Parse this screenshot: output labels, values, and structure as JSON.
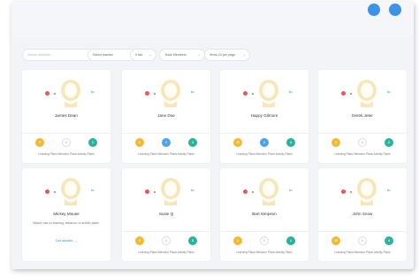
{
  "header": {
    "title": "",
    "right_labels": [
      "",
      ""
    ]
  },
  "filters": {
    "search_placeholder": "Search students",
    "selects": [
      {
        "label": "Select teacher"
      },
      {
        "label": "0 tab"
      },
      {
        "label": "Team Members"
      },
      {
        "label": "Show 24 per page"
      }
    ]
  },
  "footer_label": "Learning Plans  Behavior Plans  Activity Plans",
  "colors": {
    "yellow": "#f4b833",
    "blue": "#4da1ec",
    "teal": "#2bb39a",
    "red": "#e25959",
    "accent": "#3d93e8"
  },
  "students": [
    {
      "name": "James Dean",
      "tag": "lu",
      "learning": "0",
      "behavior": "0",
      "activity": "1",
      "b_style": "empty"
    },
    {
      "name": "Jane Doe",
      "tag": "lu",
      "learning": "0",
      "behavior": "2",
      "activity": "3",
      "b_style": "blue"
    },
    {
      "name": "Happy Gilmore",
      "tag": "lu",
      "learning": "10",
      "behavior": "2",
      "activity": "4",
      "b_style": "blue"
    },
    {
      "name": "Derek Jeter",
      "tag": "lu",
      "learning": "2",
      "behavior": "0",
      "activity": "2",
      "b_style": "empty"
    },
    {
      "name": "Mickey Mouse",
      "tag": "lu",
      "setup": true,
      "description": "Mickey has no learning, behavior, or activity plans.",
      "setup_label": "Get started →"
    },
    {
      "name": "Susie Q",
      "tag": "lu",
      "learning": "2",
      "behavior": "0",
      "activity": "3",
      "b_style": "empty"
    },
    {
      "name": "Bart Simpson",
      "tag": "lu",
      "learning": "2",
      "behavior": "0",
      "activity": "1",
      "b_style": "empty"
    },
    {
      "name": "John Snow",
      "tag": "lu",
      "learning": "10",
      "behavior": "0",
      "activity": "4",
      "b_style": "empty"
    }
  ]
}
